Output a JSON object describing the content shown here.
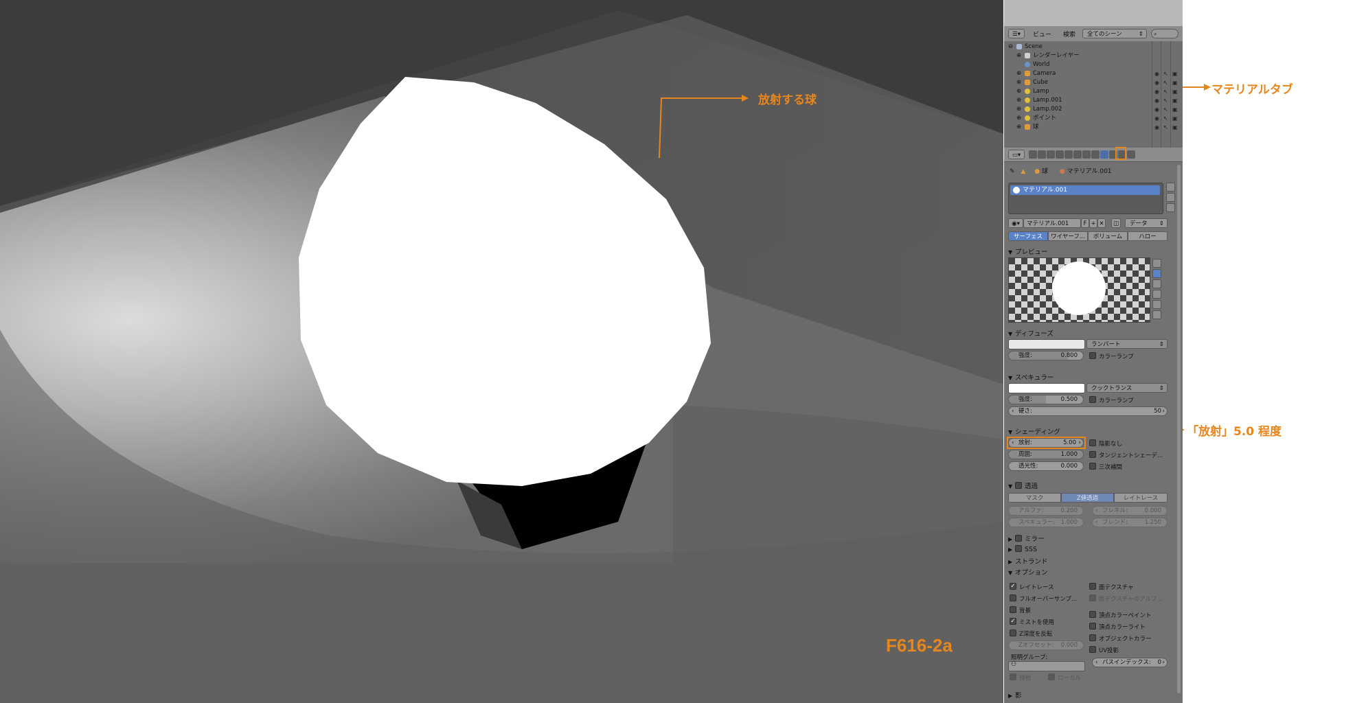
{
  "annotations": {
    "sphere": "放射する球",
    "material_tab": "マテリアルタブ",
    "emit_value": "「放射」5.0 程度"
  },
  "figure_label": "F616-2a",
  "colors": {
    "accent": "#e8861e",
    "panel_bg": "#727272",
    "selected_blue": "#5a82c8"
  },
  "outliner": {
    "view": "ビュー",
    "search": "検索",
    "scene_select": "全てのシーン",
    "items": [
      {
        "name": "Scene",
        "icon": "scene-icon"
      },
      {
        "name": "レンダーレイヤー",
        "icon": "render-layer-icon"
      },
      {
        "name": "World",
        "icon": "world-icon"
      },
      {
        "name": "Camera",
        "icon": "camera-icon"
      },
      {
        "name": "Cube",
        "icon": "mesh-icon"
      },
      {
        "name": "Lamp",
        "icon": "lamp-icon"
      },
      {
        "name": "Lamp.001",
        "icon": "lamp-icon"
      },
      {
        "name": "Lamp.002",
        "icon": "lamp-icon"
      },
      {
        "name": "ポイント",
        "icon": "lamp-icon"
      },
      {
        "name": "球",
        "icon": "mesh-icon"
      }
    ]
  },
  "breadcrumb": {
    "object": "球",
    "material": "マテリアル.001"
  },
  "material_slot": "マテリアル.001",
  "material_name": "マテリアル.001",
  "material_link": "データ",
  "fake_user": "F",
  "tabs": [
    "サーフェス",
    "ワイヤーフ...",
    "ボリューム",
    "ハロー"
  ],
  "preview": {
    "title": "プレビュー"
  },
  "diffuse": {
    "title": "ディフューズ",
    "shader": "ランバート",
    "intensity_label": "強度:",
    "intensity": "0.800",
    "intensity_fraction": 0.8,
    "ramp": "カラーランプ"
  },
  "specular": {
    "title": "スペキュラー",
    "shader": "クックトランス",
    "intensity_label": "強度:",
    "intensity": "0.500",
    "intensity_fraction": 0.5,
    "ramp": "カラーランプ",
    "hardness_label": "硬さ:",
    "hardness": "50"
  },
  "shading": {
    "title": "シェーディング",
    "emit_label": "放射:",
    "emit": "5.00",
    "ambient_label": "周囲:",
    "ambient": "1.000",
    "translucency_label": "透光性:",
    "translucency": "0.000",
    "shadeless": "陰影なし",
    "tangent": "タンジェントシェーデ...",
    "cubic": "三次補間"
  },
  "transparency": {
    "title": "透過",
    "modes": [
      "マスク",
      "Z値透過",
      "レイトレース"
    ],
    "alpha_label": "アルファ:",
    "alpha": "0.200",
    "fresnel_label": "フレネル:",
    "fresnel": "0.000",
    "specular_label": "スペキュラー:",
    "specular": "1.000",
    "blend_label": "ブレンド:",
    "blend": "1.250"
  },
  "collapsed": [
    "ミラー",
    "SSS",
    "ストランド"
  ],
  "options": {
    "title": "オプション",
    "left": [
      {
        "label": "レイトレース",
        "checked": true
      },
      {
        "label": "フルオーバーサンプ...",
        "checked": false
      },
      {
        "label": "背景",
        "checked": false
      },
      {
        "label": "ミストを使用",
        "checked": true
      },
      {
        "label": "Z深度を反転",
        "checked": false
      }
    ],
    "right": [
      {
        "label": "面テクスチャ",
        "checked": false
      },
      {
        "label": "面テクスチャのアルフ...",
        "checked": false
      },
      {
        "label": "頂点カラーペイント",
        "checked": false
      },
      {
        "label": "頂点カラーライト",
        "checked": false
      },
      {
        "label": "オブジェクトカラー",
        "checked": false
      },
      {
        "label": "UV投影",
        "checked": false
      }
    ],
    "z_offset_label": "Zオフセット:",
    "z_offset": "0.000",
    "light_group_label": "照明グループ:",
    "pass_index_label": "パスインデックス:",
    "pass_index": "0",
    "exclusive": "排他",
    "local": "ローカル"
  },
  "shadow": "影"
}
